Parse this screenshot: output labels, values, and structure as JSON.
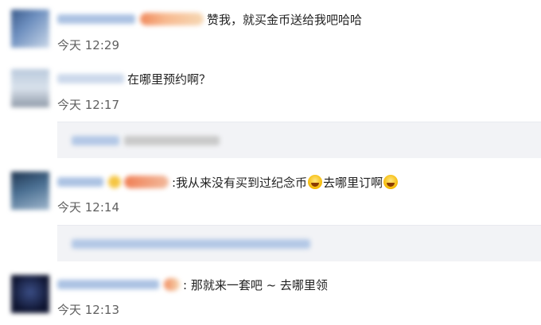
{
  "comments": [
    {
      "text": "赞我，就买金币送给我吧哈哈",
      "time": "今天 12:29"
    },
    {
      "text": "在哪里预约啊？",
      "time": "今天 12:17"
    },
    {
      "text_parts": [
        ":我从来没有买到过纪念币",
        "去哪里订啊"
      ],
      "time": "今天 12:14"
    },
    {
      "text": ": 那就来一套吧 ~ 去哪里领",
      "time": "今天 12:13"
    }
  ],
  "icons": [
    "laughing-tears-emoji",
    "laughing-tears-emoji"
  ],
  "colors": {
    "background": "#ffffff",
    "reply_box": "#f2f3f6",
    "username_blue": "#9db8de",
    "timestamp": "#606060"
  }
}
